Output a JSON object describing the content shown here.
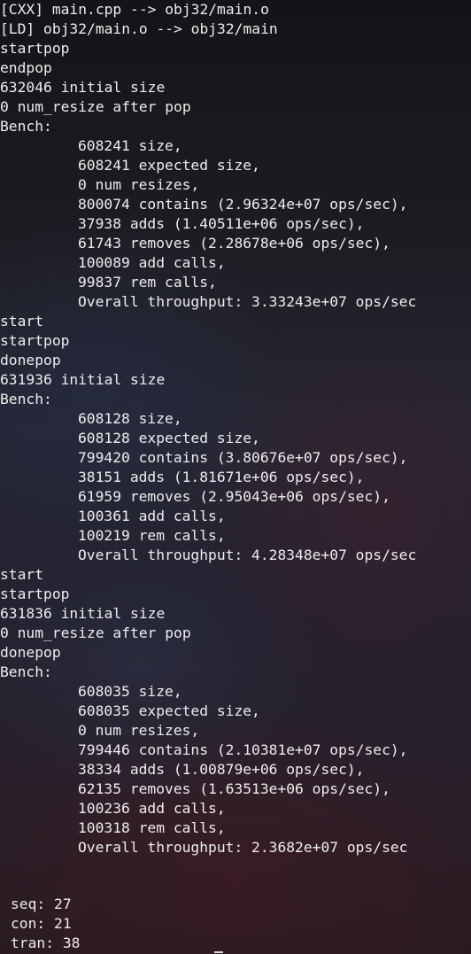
{
  "terminal": {
    "lines": [
      {
        "text": "[CXX] main.cpp --> obj32/main.o",
        "indent": false
      },
      {
        "text": "[LD] obj32/main.o --> obj32/main",
        "indent": false
      },
      {
        "text": "startpop",
        "indent": false
      },
      {
        "text": "endpop",
        "indent": false
      },
      {
        "text": "632046 initial size",
        "indent": false
      },
      {
        "text": "0 num_resize after pop",
        "indent": false
      },
      {
        "text": "Bench:",
        "indent": false
      },
      {
        "text": "608241 size,",
        "indent": true
      },
      {
        "text": "608241 expected size,",
        "indent": true
      },
      {
        "text": "0 num resizes,",
        "indent": true
      },
      {
        "text": "800074 contains (2.96324e+07 ops/sec),",
        "indent": true
      },
      {
        "text": "37938 adds (1.40511e+06 ops/sec),",
        "indent": true
      },
      {
        "text": "61743 removes (2.28678e+06 ops/sec),",
        "indent": true
      },
      {
        "text": "100089 add calls,",
        "indent": true
      },
      {
        "text": "99837 rem calls,",
        "indent": true
      },
      {
        "text": "Overall throughput: 3.33243e+07 ops/sec",
        "indent": true
      },
      {
        "text": "start",
        "indent": false
      },
      {
        "text": "startpop",
        "indent": false
      },
      {
        "text": "donepop",
        "indent": false
      },
      {
        "text": "631936 initial size",
        "indent": false
      },
      {
        "text": "Bench:",
        "indent": false
      },
      {
        "text": "608128 size,",
        "indent": true
      },
      {
        "text": "608128 expected size,",
        "indent": true
      },
      {
        "text": "799420 contains (3.80676e+07 ops/sec),",
        "indent": true
      },
      {
        "text": "38151 adds (1.81671e+06 ops/sec),",
        "indent": true
      },
      {
        "text": "61959 removes (2.95043e+06 ops/sec),",
        "indent": true
      },
      {
        "text": "100361 add calls,",
        "indent": true
      },
      {
        "text": "100219 rem calls,",
        "indent": true
      },
      {
        "text": "Overall throughput: 4.28348e+07 ops/sec",
        "indent": true
      },
      {
        "text": "start",
        "indent": false
      },
      {
        "text": "startpop",
        "indent": false
      },
      {
        "text": "631836 initial size",
        "indent": false
      },
      {
        "text": "0 num_resize after pop",
        "indent": false
      },
      {
        "text": "donepop",
        "indent": false
      },
      {
        "text": "Bench:",
        "indent": false
      },
      {
        "text": "608035 size,",
        "indent": true
      },
      {
        "text": "608035 expected size,",
        "indent": true
      },
      {
        "text": "0 num resizes,",
        "indent": true
      },
      {
        "text": "799446 contains (2.10381e+07 ops/sec),",
        "indent": true
      },
      {
        "text": "38334 adds (1.00879e+06 ops/sec),",
        "indent": true
      },
      {
        "text": "62135 removes (1.63513e+06 ops/sec),",
        "indent": true
      },
      {
        "text": "100236 add calls,",
        "indent": true
      },
      {
        "text": "100318 rem calls,",
        "indent": true
      },
      {
        "text": "Overall throughput: 2.3682e+07 ops/sec",
        "indent": true
      }
    ],
    "stats": [
      {
        "text": "seq: 27"
      },
      {
        "text": "con: 21"
      },
      {
        "text": "tran: 38"
      }
    ]
  }
}
